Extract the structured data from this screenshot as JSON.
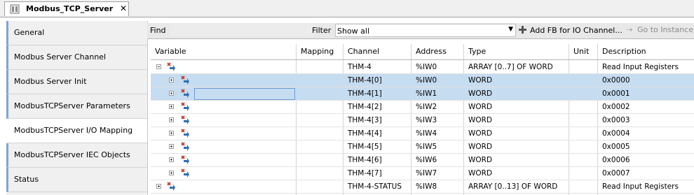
{
  "tab": {
    "title": "Modbus_TCP_Server",
    "close": "✕",
    "icon": "device-icon"
  },
  "sidebar": {
    "items": [
      {
        "label": "General",
        "active": false
      },
      {
        "label": "Modbus Server Channel",
        "active": false
      },
      {
        "label": "Modbus Server Init",
        "active": false
      },
      {
        "label": "ModbusTCPServer Parameters",
        "active": false
      },
      {
        "label": "ModbusTCPServer I/O Mapping",
        "active": true
      },
      {
        "label": "ModbusTCPServer IEC Objects",
        "active": false
      },
      {
        "label": "Status",
        "active": false
      }
    ]
  },
  "toolbar": {
    "find_label": "Find",
    "find_value": "",
    "filter_label": "Filter",
    "filter_value": "Show all",
    "add_fb_label": "Add FB for IO Channel...",
    "goto_label": "Go to Instance"
  },
  "table": {
    "columns": [
      "Variable",
      "Mapping",
      "Channel",
      "Address",
      "Type",
      "Unit",
      "Description"
    ],
    "rows": [
      {
        "level": 0,
        "expanded": true,
        "selected": false,
        "channel": "THM-4",
        "address": "%IW0",
        "type": "ARRAY [0..7] OF WORD",
        "unit": "",
        "description": "Read Input Registers"
      },
      {
        "level": 1,
        "expanded": false,
        "selected": true,
        "channel": "THM-4[0]",
        "address": "%IW0",
        "type": "WORD",
        "unit": "",
        "description": "0x0000"
      },
      {
        "level": 1,
        "expanded": false,
        "selected": true,
        "editing": true,
        "channel": "THM-4[1]",
        "address": "%IW1",
        "type": "WORD",
        "unit": "",
        "description": "0x0001"
      },
      {
        "level": 1,
        "expanded": false,
        "selected": false,
        "channel": "THM-4[2]",
        "address": "%IW2",
        "type": "WORD",
        "unit": "",
        "description": "0x0002"
      },
      {
        "level": 1,
        "expanded": false,
        "selected": false,
        "channel": "THM-4[3]",
        "address": "%IW3",
        "type": "WORD",
        "unit": "",
        "description": "0x0003"
      },
      {
        "level": 1,
        "expanded": false,
        "selected": false,
        "channel": "THM-4[4]",
        "address": "%IW4",
        "type": "WORD",
        "unit": "",
        "description": "0x0004"
      },
      {
        "level": 1,
        "expanded": false,
        "selected": false,
        "channel": "THM-4[5]",
        "address": "%IW5",
        "type": "WORD",
        "unit": "",
        "description": "0x0005"
      },
      {
        "level": 1,
        "expanded": false,
        "selected": false,
        "channel": "THM-4[6]",
        "address": "%IW6",
        "type": "WORD",
        "unit": "",
        "description": "0x0006"
      },
      {
        "level": 1,
        "expanded": false,
        "selected": false,
        "channel": "THM-4[7]",
        "address": "%IW7",
        "type": "WORD",
        "unit": "",
        "description": "0x0007"
      },
      {
        "level": 0,
        "expanded": false,
        "selected": false,
        "channel": "THM-4-STATUS",
        "address": "%IW8",
        "type": "ARRAY [0..13] OF WORD",
        "unit": "",
        "description": "Read Input Registers"
      }
    ]
  },
  "colors": {
    "selection": "#c6dcf0",
    "nav_accent": "#7ba5d6",
    "icon_red": "#c0392b",
    "icon_blue": "#2f6fb5"
  }
}
